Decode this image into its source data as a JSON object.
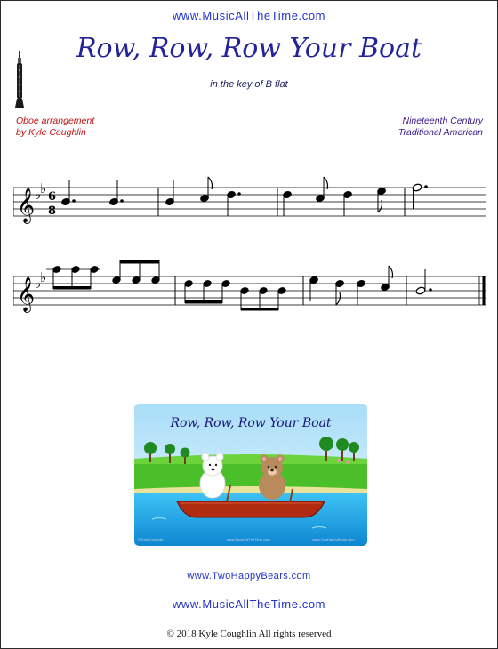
{
  "header": {
    "site": "www.MusicAllTheTime.com",
    "title": "Row, Row, Row Your Boat",
    "subtitle": "in the key of B flat"
  },
  "credits": {
    "arranger_line1": "Oboe arrangement",
    "arranger_line2": "by Kyle Coughlin",
    "origin_line1": "Nineteenth Century",
    "origin_line2": "Traditional American"
  },
  "music": {
    "instrument_icon": "oboe-icon",
    "key_signature": "B flat major",
    "time_signature": {
      "numerator": "6",
      "denominator": "8"
    },
    "staves": [
      {
        "measures": [
          [
            {
              "note": "Bb4",
              "dur": "dotted-quarter"
            },
            {
              "note": "Bb4",
              "dur": "dotted-quarter"
            }
          ],
          [
            {
              "note": "Bb4",
              "dur": "quarter"
            },
            {
              "note": "C5",
              "dur": "eighth"
            },
            {
              "note": "D5",
              "dur": "dotted-quarter"
            }
          ],
          [
            {
              "note": "D5",
              "dur": "quarter"
            },
            {
              "note": "C5",
              "dur": "eighth"
            },
            {
              "note": "D5",
              "dur": "quarter"
            },
            {
              "note": "Eb5",
              "dur": "eighth"
            }
          ],
          [
            {
              "note": "F5",
              "dur": "dotted-half"
            }
          ]
        ]
      },
      {
        "measures": [
          [
            {
              "note": "Bb5",
              "dur": "eighth"
            },
            {
              "note": "Bb5",
              "dur": "eighth"
            },
            {
              "note": "Bb5",
              "dur": "eighth"
            },
            {
              "note": "F5",
              "dur": "eighth"
            },
            {
              "note": "F5",
              "dur": "eighth"
            },
            {
              "note": "F5",
              "dur": "eighth"
            }
          ],
          [
            {
              "note": "D5",
              "dur": "eighth"
            },
            {
              "note": "D5",
              "dur": "eighth"
            },
            {
              "note": "D5",
              "dur": "eighth"
            },
            {
              "note": "Bb4",
              "dur": "eighth"
            },
            {
              "note": "Bb4",
              "dur": "eighth"
            },
            {
              "note": "Bb4",
              "dur": "eighth"
            }
          ],
          [
            {
              "note": "F5",
              "dur": "quarter"
            },
            {
              "note": "Eb5",
              "dur": "eighth"
            },
            {
              "note": "D5",
              "dur": "quarter"
            },
            {
              "note": "C5",
              "dur": "eighth"
            }
          ],
          [
            {
              "note": "Bb4",
              "dur": "dotted-half"
            }
          ]
        ]
      }
    ]
  },
  "illustration": {
    "title": "Row, Row, Row Your Boat",
    "credit_left": "© Kyle Coughlin",
    "credit_mid": "www.MusicAllTheTime.com",
    "credit_right": "www.TwoHappyBears.com",
    "colors": {
      "sky": "#c8ecff",
      "grass": "#4bbf2a",
      "water": "#1fa6e6",
      "boat": "#b12a12"
    }
  },
  "footer": {
    "link1": "www.TwoHappyBears.com",
    "site": "www.MusicAllTheTime.com",
    "copyright": "© 2018 Kyle Coughlin All rights reserved"
  }
}
